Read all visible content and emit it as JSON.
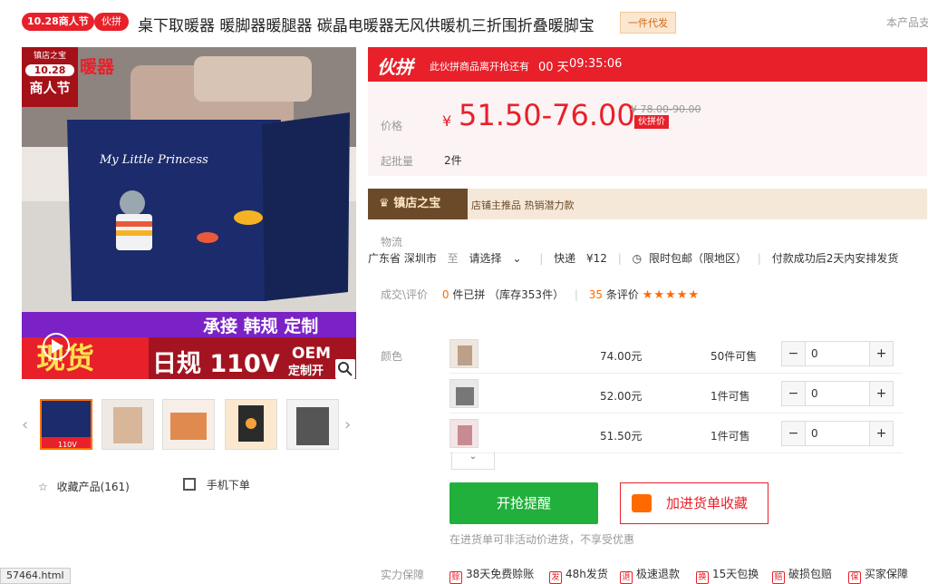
{
  "header": {
    "badge_date": "10.28商人节",
    "badge_hp": "伙拼",
    "title": "桌下取暖器 暖脚器暖腿器 碳晶电暖器无风供暖机三折围折叠暖脚宝",
    "dropship": "一件代发",
    "notice_right": "本产品支"
  },
  "gallery": {
    "corner_logo_top": "镇店之宝",
    "corner_logo_date": "10.28",
    "corner_logo_text": "商人节",
    "banner_top": "暖器",
    "product_text": "My Little Princess",
    "purple_banner": "承接 韩规 定制",
    "spot": "现货",
    "bottom_banner": "日规 110V",
    "oem_1": "OEM",
    "oem_2": "定制开",
    "thumb_caption": "110V",
    "tooltip_url": "57464.html"
  },
  "actions": {
    "favorite": "收藏产品(161)",
    "mobile_order": "手机下单"
  },
  "flash": {
    "logo": "伙拼",
    "countdown_label": "此伙拼商品离开抢还有",
    "countdown_days": "00 天",
    "countdown_time": "09:35:06"
  },
  "price": {
    "label": "价格",
    "currency": "¥",
    "range": "51.50-76.00",
    "original": "¥ 78.00-90.00",
    "tag": "伙拼价",
    "moq_label": "起批量",
    "moq_value": "2件"
  },
  "shop": {
    "title": "镇店之宝",
    "tags": "店铺主推品   热销潜力款"
  },
  "shipping": {
    "label": "物流",
    "from": "广东省 深圳市",
    "to_label": "至",
    "to_select": "请选择",
    "express": "快递",
    "fee": "¥12",
    "limited": "限时包邮（限地区）",
    "ship_promise": "付款成功后2天内安排发货"
  },
  "deal": {
    "label": "成交\\评价",
    "sold": "0",
    "sold_text": "件已拼 （库存353件）",
    "reviews": "35",
    "reviews_text": "条评价",
    "stars": "★★★★★"
  },
  "sku": {
    "label": "颜色",
    "rows": [
      {
        "price": "74.00元",
        "stock": "50件可售",
        "qty": "0"
      },
      {
        "price": "52.00元",
        "stock": "1件可售",
        "qty": "0"
      },
      {
        "price": "51.50元",
        "stock": "1件可售",
        "qty": "0"
      }
    ]
  },
  "buttons": {
    "buy": "开抢提醒",
    "add_cart": "加进货单收藏",
    "tip": "在进货单可非活动价进货，不享受优惠"
  },
  "guarantee": {
    "label": "实力保障",
    "items": [
      "38天免费赊账",
      "48h发货",
      "极速退款",
      "15天包换",
      "破损包赔",
      "买家保障"
    ]
  },
  "colors": {
    "accent_red": "#e8202a",
    "green": "#21b03b",
    "orange": "#ff6a00"
  }
}
